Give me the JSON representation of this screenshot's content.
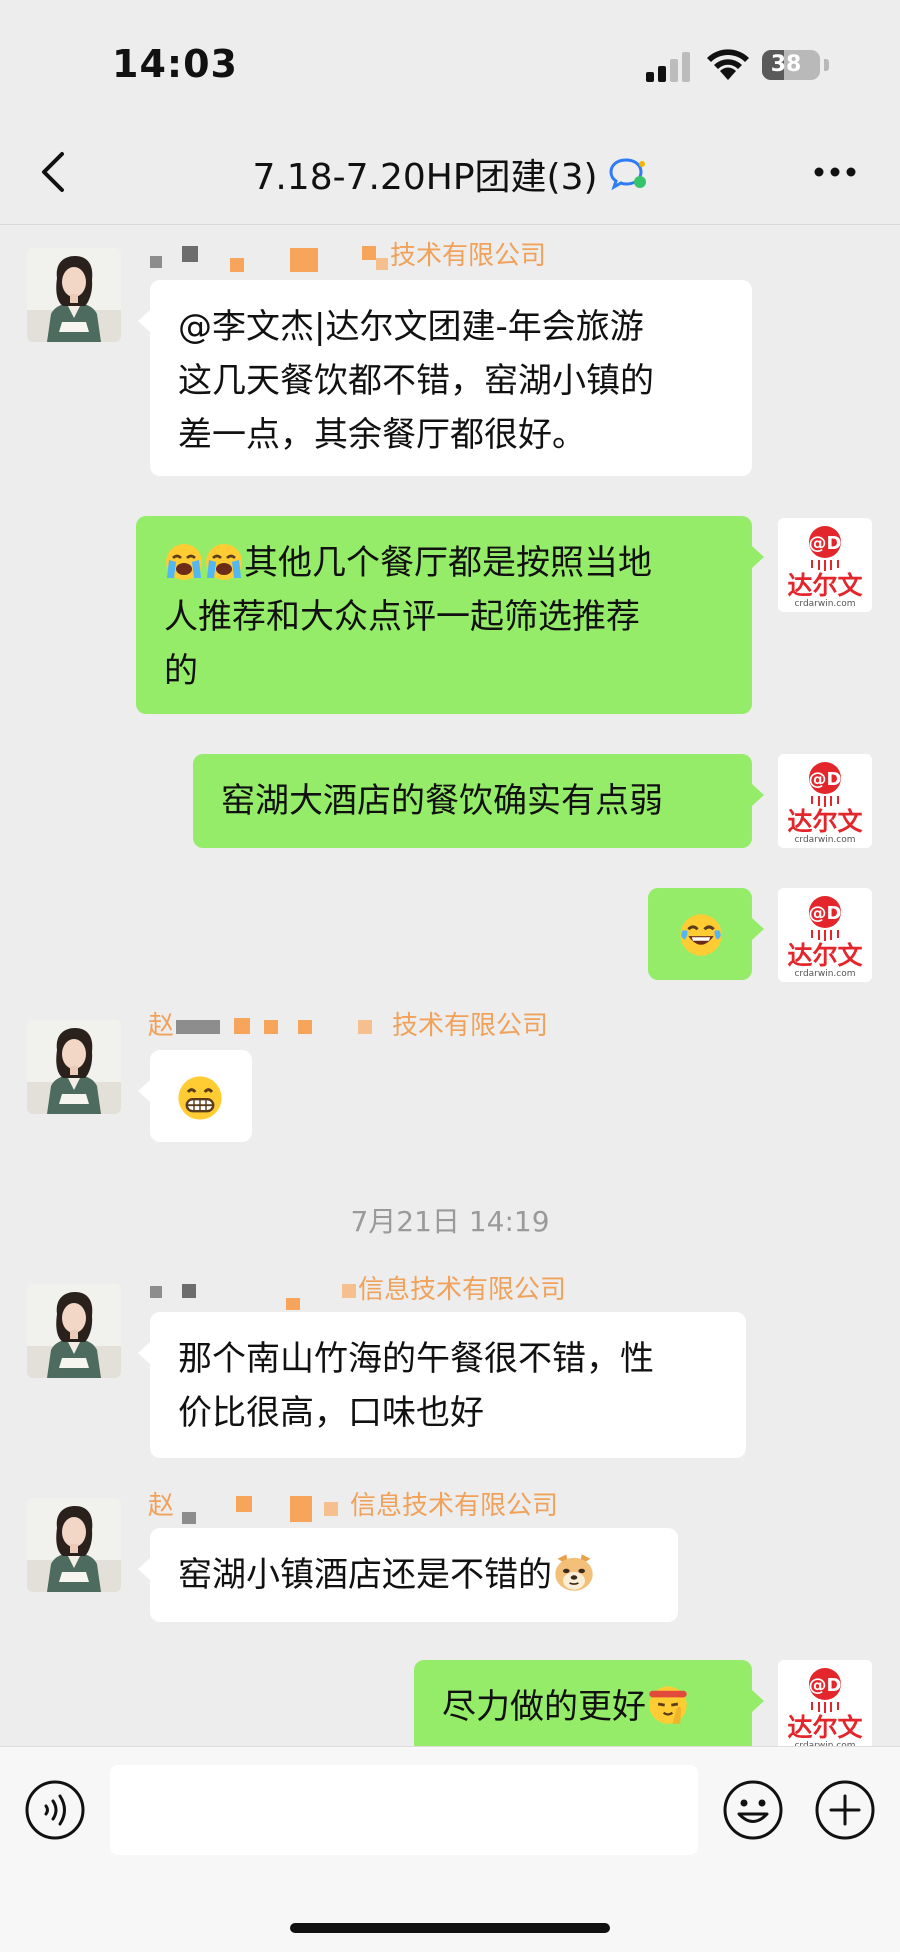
{
  "status_bar": {
    "time": "14:03",
    "battery": "38",
    "battery_level": 0.38
  },
  "nav": {
    "title": "7.18-7.20HP团建(3)"
  },
  "messages": [
    {
      "side": "left",
      "sender_suffix": "技术有限公司",
      "lines": [
        "@李文杰|达尔文团建-年会旅游",
        "这几天餐饮都不错，窑湖小镇的",
        "差一点，其余餐厅都很好。"
      ]
    },
    {
      "side": "right",
      "lines": [
        "其他几个餐厅都是按照当地",
        "人推荐和大众点评一起筛选推荐",
        "的"
      ],
      "leading_emoji": [
        "loudly-crying-face",
        "loudly-crying-face"
      ]
    },
    {
      "side": "right",
      "lines": [
        "窑湖大酒店的餐饮确实有点弱"
      ]
    },
    {
      "side": "right",
      "emoji": "tears-of-joy-face"
    },
    {
      "side": "left",
      "sender_prefix": "赵",
      "sender_suffix": "技术有限公司",
      "emoji": "grinning-face"
    },
    {
      "timestamp": "7月21日 14:19"
    },
    {
      "side": "left",
      "sender_suffix": "信息技术有限公司",
      "lines": [
        "那个南山竹海的午餐很不错，性",
        "价比很高，口味也好"
      ]
    },
    {
      "side": "left",
      "sender_prefix": "赵",
      "sender_suffix": "信息技术有限公司",
      "lines": [
        "窑湖小镇酒店还是不错的"
      ],
      "trailing_emoji": "doge-face"
    },
    {
      "side": "right",
      "lines": [
        "尽力做的更好"
      ],
      "trailing_emoji": "saluting-face-headband"
    }
  ],
  "logo": {
    "brand_text": "达尔文",
    "domain_text": "crdarwin.com",
    "color": "#e3262b"
  },
  "input": {
    "placeholder": ""
  },
  "colors": {
    "green_bubble": "#95ec69",
    "white_bubble": "#ffffff",
    "background": "#ededed",
    "sender_name": "#f0a15a"
  }
}
